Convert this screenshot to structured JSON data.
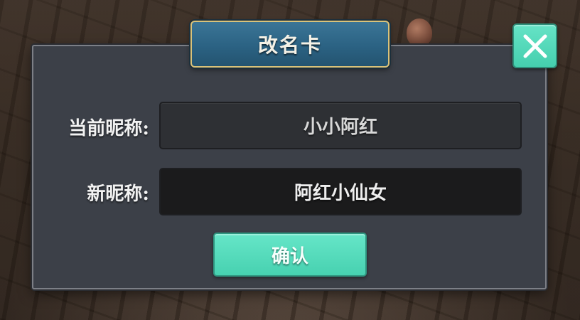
{
  "dialog": {
    "title": "改名卡",
    "close_icon": "close-icon",
    "current_nickname": {
      "label": "当前昵称:",
      "value": "小小阿红"
    },
    "new_nickname": {
      "label": "新昵称:",
      "value": "阿红小仙女"
    },
    "confirm_label": "确认"
  },
  "colors": {
    "panel": "#3c4048",
    "title_plate": "#2b6283",
    "title_border": "#d9c27a",
    "accent_button": "#47d1b0",
    "field_current": "#2e3034",
    "field_new": "#1b1b1c"
  }
}
